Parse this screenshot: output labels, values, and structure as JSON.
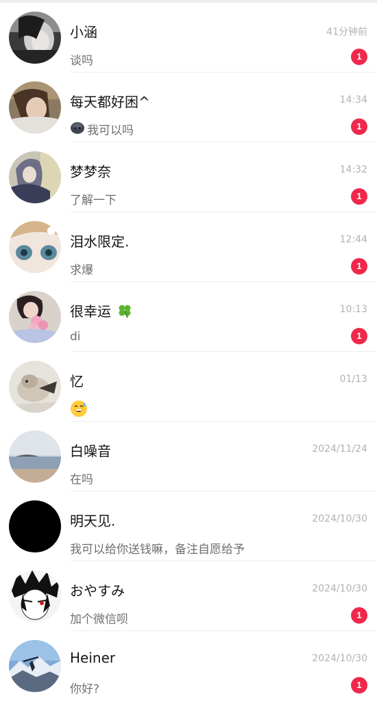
{
  "conversations": [
    {
      "name": "小涵",
      "time": "41分钟前",
      "preview": "谈吗",
      "unread": "1",
      "avatar": "girl-selfie-avatar"
    },
    {
      "name": "每天都好困^",
      "time": "14:34",
      "preview": "我可以吗",
      "unread": "1",
      "avatar": "girl-lying-avatar",
      "preview_icon": "dark-blob-emoji"
    },
    {
      "name": "梦梦奈",
      "time": "14:32",
      "preview": "了解一下",
      "unread": "1",
      "avatar": "hooded-girl-avatar"
    },
    {
      "name": "泪水限定.",
      "time": "12:44",
      "preview": "求爆",
      "unread": "1",
      "avatar": "anime-closeup-avatar"
    },
    {
      "name": "很幸运",
      "time": "10:13",
      "preview": "di",
      "unread": "1",
      "avatar": "girl-with-flowers-avatar",
      "name_icon": "four-leaf-clover-icon"
    },
    {
      "name": "忆",
      "time": "01/13",
      "preview": "",
      "unread": "",
      "avatar": "cat-avatar",
      "preview_icon": "sweat-smile-emoji"
    },
    {
      "name": "白噪音",
      "time": "2024/11/24",
      "preview": "在吗",
      "unread": "",
      "avatar": "sea-landscape-avatar"
    },
    {
      "name": "明天见.",
      "time": "2024/10/30",
      "preview": "我可以给你送钱嘛，备注自愿给予",
      "unread": "",
      "avatar": "black-avatar"
    },
    {
      "name": "おやすみ",
      "time": "2024/10/30",
      "preview": "加个微信呗",
      "unread": "1",
      "avatar": "anime-boy-avatar"
    },
    {
      "name": "Heiner",
      "time": "2024/10/30",
      "preview": "你好?",
      "unread": "1",
      "avatar": "mountain-avatar"
    }
  ],
  "colors": {
    "badge": "#f0284c",
    "name": "#161616",
    "time": "#b2b2b2",
    "preview": "#6e6e6e",
    "separator": "#ececec"
  }
}
